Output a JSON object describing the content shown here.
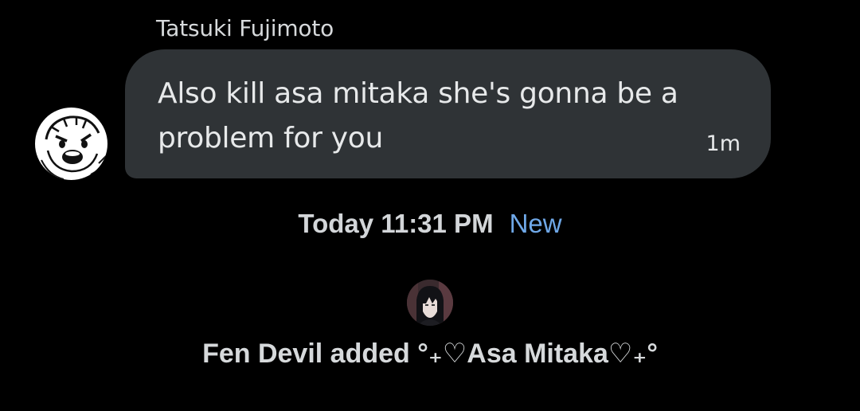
{
  "message": {
    "sender_name": "Tatsuki Fujimoto",
    "sender_avatar_icon": "cartoon-face-avatar-icon",
    "text": "Also kill asa mitaka she's gonna be a problem for you",
    "timestamp": "1m",
    "bubble_color": "#2f3336"
  },
  "divider": {
    "date": "Today 11:31 PM",
    "new_label": "New",
    "new_color": "#6fa8e8"
  },
  "event": {
    "avatar_icon": "user-avatar-icon",
    "text": "Fen Devil added °₊♡Asa Mitaka♡₊°"
  }
}
